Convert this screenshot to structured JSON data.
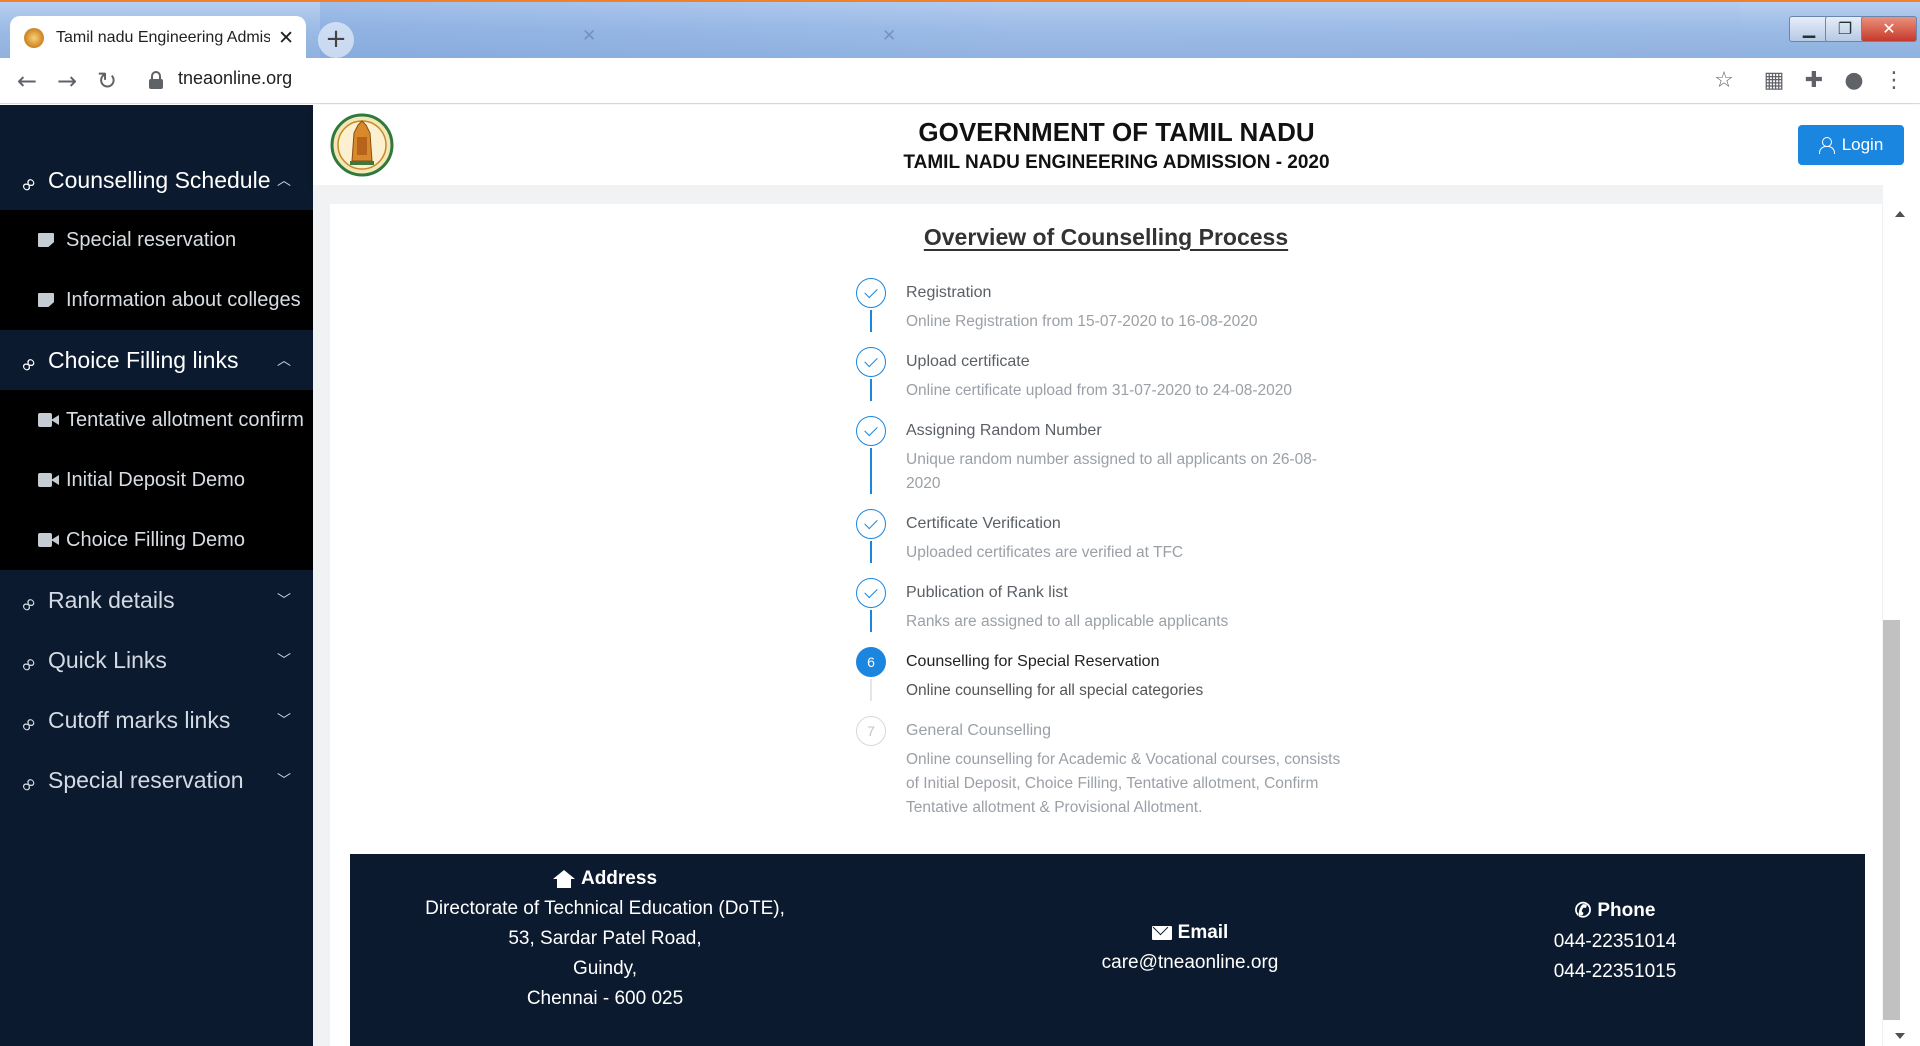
{
  "browser": {
    "active_tab_title": "Tamil nadu Engineering Admissio",
    "url": "tneaonline.org"
  },
  "header": {
    "title": "GOVERNMENT OF TAMIL NADU",
    "subtitle": "TAMIL NADU ENGINEERING ADMISSION - 2020",
    "login_label": "Login"
  },
  "sidebar": {
    "sections": [
      {
        "label": "Counselling Schedule",
        "expanded": true,
        "items": [
          "Special reservation",
          "Information about colleges"
        ]
      },
      {
        "label": "Choice Filling links",
        "expanded": true,
        "items": [
          "Tentative allotment confirm",
          "Initial Deposit Demo",
          "Choice Filling Demo"
        ]
      },
      {
        "label": "Rank details",
        "expanded": false
      },
      {
        "label": "Quick Links",
        "expanded": false
      },
      {
        "label": "Cutoff marks links",
        "expanded": false
      },
      {
        "label": "Special reservation",
        "expanded": false
      }
    ]
  },
  "overview": {
    "title": "Overview of Counselling Process",
    "steps": [
      {
        "title": "Registration",
        "desc": "Online Registration from 15-07-2020 to 16-08-2020",
        "status": "done"
      },
      {
        "title": "Upload certificate",
        "desc": "Online certificate upload from 31-07-2020 to 24-08-2020",
        "status": "done"
      },
      {
        "title": "Assigning Random Number",
        "desc": "Unique random number assigned to all applicants on 26-08-2020",
        "status": "done"
      },
      {
        "title": "Certificate Verification",
        "desc": "Uploaded certificates are verified at TFC",
        "status": "done"
      },
      {
        "title": "Publication of Rank list",
        "desc": "Ranks are assigned to all applicable applicants",
        "status": "done"
      },
      {
        "title": "Counselling for Special Reservation",
        "desc": "Online counselling for all special categories",
        "status": "current",
        "number": "6"
      },
      {
        "title": "General Counselling",
        "desc": "Online counselling for Academic & Vocational courses, consists of Initial Deposit, Choice Filling, Tentative allotment, Confirm Tentative allotment & Provisional Allotment.",
        "status": "pending",
        "number": "7"
      }
    ]
  },
  "footer": {
    "address": {
      "heading": "Address",
      "lines": [
        "Directorate of Technical Education (DoTE),",
        "53, Sardar Patel Road,",
        "Guindy,",
        "Chennai - 600 025"
      ]
    },
    "email": {
      "heading": "Email",
      "value": "care@tneaonline.org"
    },
    "phone": {
      "heading": "Phone",
      "values": [
        "044-22351014",
        "044-22351015"
      ]
    }
  },
  "colors": {
    "sidebar_bg": "#0b1a2e",
    "accent": "#1a86e0",
    "footer_bg": "#0b1a2e"
  }
}
